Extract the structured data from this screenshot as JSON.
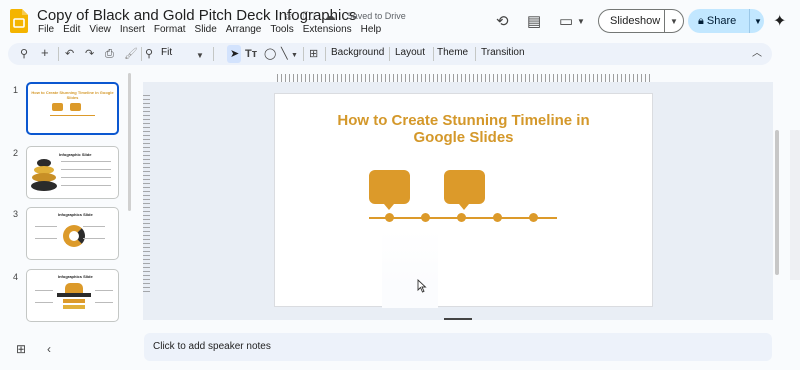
{
  "doc": {
    "title": "Copy of Black and Gold Pitch Deck Infographics",
    "saved_status": "Saved to Drive"
  },
  "menu": [
    "File",
    "Edit",
    "View",
    "Insert",
    "Format",
    "Slide",
    "Arrange",
    "Tools",
    "Extensions",
    "Help"
  ],
  "header_actions": {
    "slideshow_label": "Slideshow",
    "share_label": "Share"
  },
  "toolbar": {
    "zoom_label": "Fit",
    "background_label": "Background",
    "layout_label": "Layout",
    "theme_label": "Theme",
    "transition_label": "Transition"
  },
  "filmstrip": {
    "slides": [
      {
        "number": "1",
        "title": "How to Create Stunning Timeline in Google Slides"
      },
      {
        "number": "2",
        "title": "Infographic Slide"
      },
      {
        "number": "3",
        "title": "Infographics Slide"
      },
      {
        "number": "4",
        "title": "Infographics Slide"
      }
    ]
  },
  "slide": {
    "title_line1": "How to Create Stunning Timeline in",
    "title_line2": "Google Slides"
  },
  "notes_placeholder": "Click to add speaker notes",
  "colors": {
    "accent_gold": "#dc9a2a",
    "title_gold": "#d4982a",
    "selection_blue": "#0b57d0",
    "share_bg": "#c2e7ff"
  }
}
